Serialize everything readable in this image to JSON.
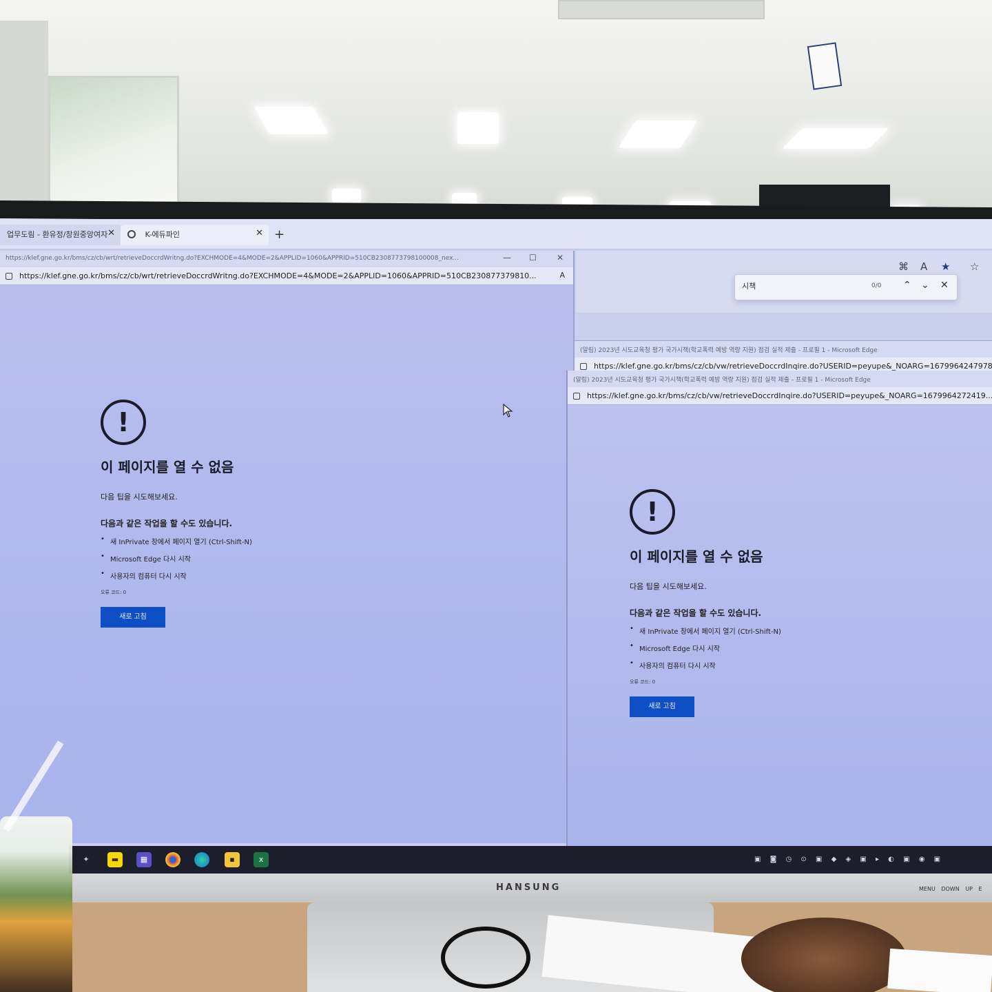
{
  "browser": {
    "tabs": [
      {
        "label": "업무도림 - 환유정/창원중앙여자"
      },
      {
        "label": "K-에듀파인"
      }
    ],
    "new_tab_label": "+"
  },
  "find_bar": {
    "query": "시책",
    "count": "0/0"
  },
  "left_window": {
    "title_url": "https://klef.gne.go.kr/bms/cz/cb/wrt/retrieveDoccrdWritng.do?EXCHMODE=4&MODE=2&APPLID=1060&APPRID=510CB2308773798100008_nex...",
    "address": "https://klef.gne.go.kr/bms/cz/cb/wrt/retrieveDoccrdWritng.do?EXCHMODE=4&MODE=2&APPLID=1060&APPRID=510CB230877379810..."
  },
  "back_window": {
    "title": "(알림) 2023년 시도교육청 평가 국가시책(학교폭력 예방 역량 지원) 점검 실적 제출 - 프로필 1 - Microsoft Edge",
    "address": "https://klef.gne.go.kr/bms/cz/cb/vw/retrieveDoccrdInqire.do?USERID=peyupe&_NOARG=1679964247978..."
  },
  "right_window": {
    "title": "(알림) 2023년 시도교육청 평가 국가시책(학교폭력 예방 역량 지원) 점검 실적 제출 - 프로필 1 - Microsoft Edge",
    "address": "https://klef.gne.go.kr/bms/cz/cb/vw/retrieveDoccrdInqire.do?USERID=peyupe&_NOARG=1679964272419..."
  },
  "error_page": {
    "icon": "!",
    "title": "이 페이지를 열 수 없음",
    "tip": "다음 팁을 시도해보세요.",
    "subheading": "다음과 같은 작업을 할 수도 있습니다.",
    "actions": [
      "새 InPrivate 창에서 페이지 열기 (Ctrl-Shift-N)",
      "Microsoft Edge 다시 시작",
      "사용자의 컴퓨터 다시 시작"
    ],
    "error_code": "오류 코드: 0",
    "refresh_label": "새로 고침"
  },
  "monitor": {
    "brand": "HANSUNG",
    "buttons": "MENU DOWN UP E"
  },
  "colors": {
    "screen_tint": "#aab4ed",
    "refresh_button": "#0f4fc6",
    "taskbar": "#1c1e2b"
  },
  "taskbar_icons": [
    "app-icon",
    "kakaotalk-icon",
    "calendar-icon",
    "chrome-icon",
    "edge-icon",
    "sticky-notes-icon",
    "excel-icon"
  ]
}
